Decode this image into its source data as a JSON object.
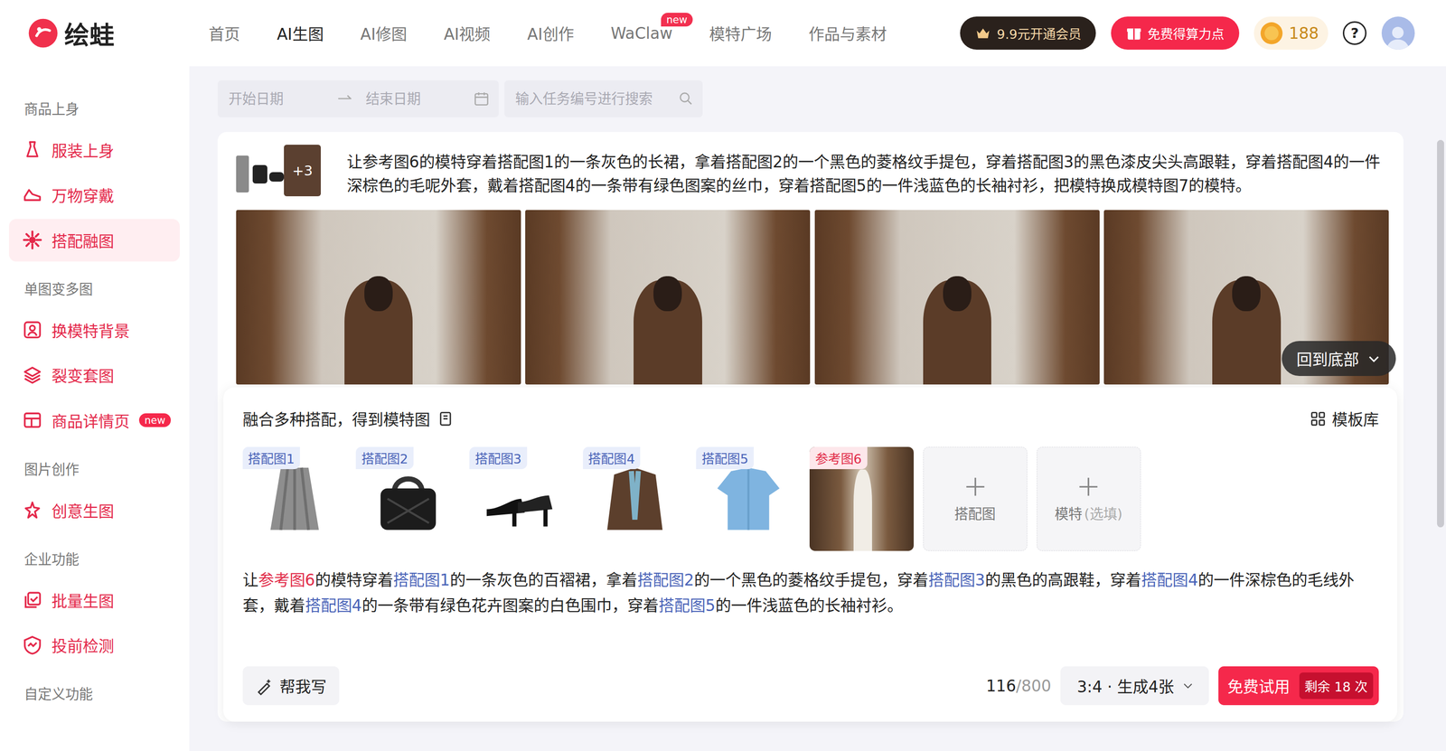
{
  "logo": {
    "text": "绘蛙"
  },
  "nav": [
    {
      "label": "首页",
      "selected": false
    },
    {
      "label": "AI生图",
      "selected": true
    },
    {
      "label": "AI修图",
      "selected": false
    },
    {
      "label": "AI视频",
      "selected": false
    },
    {
      "label": "AI创作",
      "selected": false
    },
    {
      "label": "WaClaw",
      "selected": false,
      "badge": "new"
    },
    {
      "label": "模特广场",
      "selected": false
    },
    {
      "label": "作品与素材",
      "selected": false
    }
  ],
  "header_actions": {
    "vip": "9.9元开通会员",
    "free_points": "免费得算力点",
    "coins": "188",
    "help": "?"
  },
  "sidebar": {
    "sections": [
      {
        "title": "商品上身",
        "items": [
          {
            "label": "服装上身",
            "selected": false
          },
          {
            "label": "万物穿戴",
            "selected": false
          },
          {
            "label": "搭配融图",
            "selected": true
          }
        ]
      },
      {
        "title": "单图变多图",
        "items": [
          {
            "label": "换模特背景",
            "selected": false
          },
          {
            "label": "裂变套图",
            "selected": false
          },
          {
            "label": "商品详情页",
            "selected": false,
            "badge": "new"
          }
        ]
      },
      {
        "title": "图片创作",
        "items": [
          {
            "label": "创意生图",
            "selected": false
          }
        ]
      },
      {
        "title": "企业功能",
        "items": [
          {
            "label": "批量生图",
            "selected": false
          },
          {
            "label": "投前检测",
            "selected": false
          }
        ]
      },
      {
        "title": "自定义功能",
        "items": []
      }
    ]
  },
  "filter": {
    "start_placeholder": "开始日期",
    "end_placeholder": "结束日期",
    "search_placeholder": "输入任务编号进行搜索"
  },
  "task": {
    "extra_count": "+3",
    "prompt": "让参考图6的模特穿着搭配图1的一条灰色的长裙，拿着搭配图2的一个黑色的菱格纹手提包，穿着搭配图3的黑色漆皮尖头高跟鞋，穿着搭配图4的一件深棕色的毛呢外套，戴着搭配图4的一条带有绿色图案的丝巾，穿着搭配图5的一件浅蓝色的长袖衬衫，把模特换成模特图7的模特。",
    "results": [
      {
        "kind": "photo"
      },
      {
        "kind": "photo"
      },
      {
        "kind": "photo"
      },
      {
        "kind": "photo"
      }
    ]
  },
  "back_to_bottom": "回到底部",
  "composer": {
    "title": "融合多种搭配，得到模特图",
    "template_lib": "模板库",
    "tiles": [
      {
        "label": "搭配图1",
        "kind": "match"
      },
      {
        "label": "搭配图2",
        "kind": "match"
      },
      {
        "label": "搭配图3",
        "kind": "match"
      },
      {
        "label": "搭配图4",
        "kind": "match"
      },
      {
        "label": "搭配图5",
        "kind": "match"
      },
      {
        "label": "参考图6",
        "kind": "reference"
      },
      {
        "label": "搭配图",
        "kind": "add"
      },
      {
        "label": "模特",
        "kind": "add",
        "hint": "(选填)"
      }
    ],
    "prompt": [
      {
        "text": "让",
        "kind": "text"
      },
      {
        "text": "参考图6",
        "kind": "reference"
      },
      {
        "text": "的模特穿着",
        "kind": "text"
      },
      {
        "text": "搭配图1",
        "kind": "match"
      },
      {
        "text": "的一条灰色的百褶裙，拿着",
        "kind": "text"
      },
      {
        "text": "搭配图2",
        "kind": "match"
      },
      {
        "text": "的一个黑色的菱格纹手提包，穿着",
        "kind": "text"
      },
      {
        "text": "搭配图3",
        "kind": "match"
      },
      {
        "text": "的黑色的高跟鞋，穿着",
        "kind": "text"
      },
      {
        "text": "搭配图4",
        "kind": "match"
      },
      {
        "text": "的一件深棕色的毛线外套，戴着",
        "kind": "text"
      },
      {
        "text": "搭配图4",
        "kind": "match"
      },
      {
        "text": "的一条带有绿色花卉图案的白色围巾，穿着",
        "kind": "text"
      },
      {
        "text": "搭配图5",
        "kind": "match"
      },
      {
        "text": "的一件浅蓝色的长袖衬衫。",
        "kind": "text"
      }
    ],
    "help_write": "帮我写",
    "count": "116",
    "limit": "/800",
    "ratio": "3:4 · 生成4张",
    "submit": "免费试用",
    "remaining": "剩余 18 次"
  }
}
